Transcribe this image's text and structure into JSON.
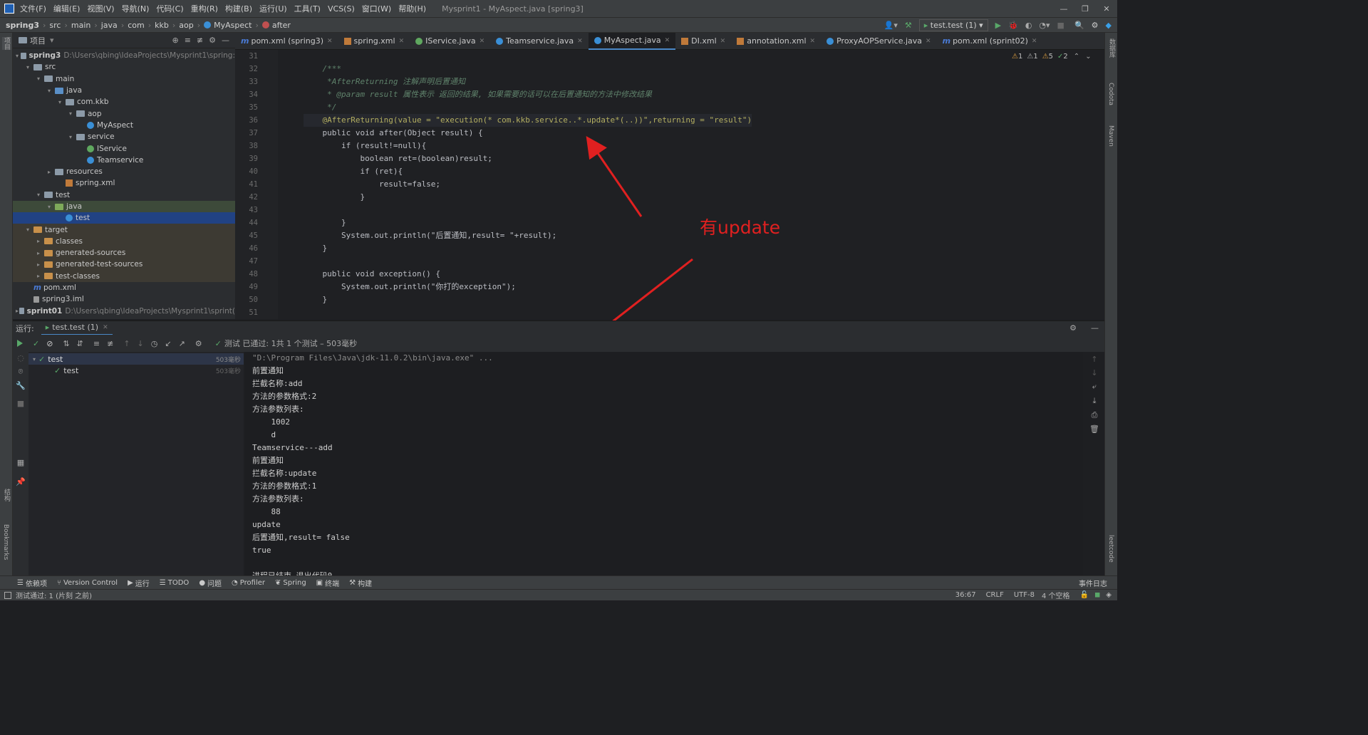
{
  "window": {
    "title": "Mysprint1 - MyAspect.java [spring3]",
    "menus": [
      "文件(F)",
      "编辑(E)",
      "视图(V)",
      "导航(N)",
      "代码(C)",
      "重构(R)",
      "构建(B)",
      "运行(U)",
      "工具(T)",
      "VCS(S)",
      "窗口(W)",
      "帮助(H)"
    ]
  },
  "breadcrumb": [
    "spring3",
    "src",
    "main",
    "java",
    "com",
    "kkb",
    "aop",
    "MyAspect",
    "after"
  ],
  "run_config": "test.test (1)",
  "project": {
    "header": "项目",
    "tree": [
      {
        "label": "spring3",
        "extra": "D:\\Users\\qbing\\IdeaProjects\\Mysprint1\\spring:",
        "icon": "module",
        "level": 0
      },
      {
        "label": "src",
        "icon": "folder",
        "level": 1
      },
      {
        "label": "main",
        "icon": "folder",
        "level": 2
      },
      {
        "label": "java",
        "icon": "folder-blue",
        "level": 3
      },
      {
        "label": "com.kkb",
        "icon": "package",
        "level": 4
      },
      {
        "label": "aop",
        "icon": "package",
        "level": 5
      },
      {
        "label": "MyAspect",
        "icon": "class",
        "level": 6
      },
      {
        "label": "service",
        "icon": "package",
        "level": 5
      },
      {
        "label": "IService",
        "icon": "interface",
        "level": 6
      },
      {
        "label": "Teamservice",
        "icon": "class",
        "level": 6
      },
      {
        "label": "resources",
        "icon": "folder",
        "level": 3
      },
      {
        "label": "spring.xml",
        "icon": "xml",
        "level": 4
      },
      {
        "label": "test",
        "icon": "folder",
        "level": 2
      },
      {
        "label": "java",
        "icon": "folder-green",
        "level": 3
      },
      {
        "label": "test",
        "icon": "class",
        "level": 4
      },
      {
        "label": "target",
        "icon": "folder-orange",
        "level": 1
      },
      {
        "label": "classes",
        "icon": "folder-orange",
        "level": 2
      },
      {
        "label": "generated-sources",
        "icon": "folder-orange",
        "level": 2
      },
      {
        "label": "generated-test-sources",
        "icon": "folder-orange",
        "level": 2
      },
      {
        "label": "test-classes",
        "icon": "folder-orange",
        "level": 2
      },
      {
        "label": "pom.xml",
        "icon": "maven",
        "level": 1
      },
      {
        "label": "spring3.iml",
        "icon": "iml",
        "level": 1
      },
      {
        "label": "sprint01",
        "extra": "D:\\Users\\qbing\\IdeaProjects\\Mysprint1\\sprint(",
        "icon": "module",
        "level": 0
      }
    ]
  },
  "tabs": [
    {
      "label": "pom.xml (spring3)",
      "icon": "maven"
    },
    {
      "label": "spring.xml",
      "icon": "xml"
    },
    {
      "label": "IService.java",
      "icon": "interface"
    },
    {
      "label": "Teamservice.java",
      "icon": "class"
    },
    {
      "label": "MyAspect.java",
      "icon": "class",
      "active": true
    },
    {
      "label": "DI.xml",
      "icon": "xml"
    },
    {
      "label": "annotation.xml",
      "icon": "xml"
    },
    {
      "label": "ProxyAOPService.java",
      "icon": "class"
    },
    {
      "label": "pom.xml (sprint02)",
      "icon": "maven"
    }
  ],
  "inspections": {
    "w1": "1",
    "w2": "1",
    "w3": "5",
    "ok": "2"
  },
  "editor": {
    "line_numbers": [
      "31",
      "32",
      "33",
      "34",
      "35",
      "36",
      "37",
      "38",
      "39",
      "40",
      "41",
      "42",
      "43",
      "44",
      "45",
      "46",
      "47",
      "48",
      "49",
      "50",
      "51"
    ],
    "lines": [
      "",
      "    /***",
      "     *AfterReturning 注解声明后置通知",
      "     * @param result 属性表示 返回的结果, 如果需要的话可以在后置通知的方法中修改结果",
      "     */",
      "    @AfterReturning(value = \"execution(* com.kkb.service..*.update*(..))\",returning = \"result\")",
      "    public void after(Object result) {",
      "        if (result!=null){",
      "            boolean ret=(boolean)result;",
      "            if (ret){",
      "                result=false;",
      "            }",
      "",
      "        }",
      "        System.out.println(\"后置通知,result= \"+result);",
      "    }",
      "",
      "    public void exception() {",
      "        System.out.println(\"你打的exception\");",
      "    }",
      ""
    ]
  },
  "annotation": {
    "text": "有update",
    "color": "#e02020"
  },
  "run": {
    "label": "运行:",
    "tab": "test.test (1)",
    "status": "测试 已通过: 1共 1 个测试 – 503毫秒",
    "tree": [
      {
        "label": "test",
        "time": "503毫秒"
      },
      {
        "label": "test",
        "time": "503毫秒"
      }
    ],
    "console": [
      "\"D:\\Program Files\\Java\\jdk-11.0.2\\bin\\java.exe\" ...",
      "前置通知",
      "拦截名称:add",
      "方法的参数格式:2",
      "方法参数列表:",
      "    1002",
      "    d",
      "Teamservice---add",
      "前置通知",
      "拦截名称:update",
      "方法的参数格式:1",
      "方法参数列表:",
      "    88",
      "update",
      "后置通知,result= false",
      "true",
      "",
      "进程已结束,退出代码0"
    ]
  },
  "toolwindows": [
    "依赖项",
    "Version Control",
    "运行",
    "TODO",
    "问题",
    "Profiler",
    "Spring",
    "终端",
    "构建"
  ],
  "event_log": "事件日志",
  "status": {
    "message": "测试通过: 1 (片刻 之前)",
    "position": "36:67",
    "line_sep": "CRLF",
    "encoding": "UTF-8",
    "indent": "4 个空格"
  },
  "side": {
    "left1": "项目",
    "left2": "结构",
    "left3": "Bookmarks",
    "right1": "数据库",
    "right2": "Codota",
    "right3": "Maven",
    "right4": "leetcode"
  },
  "colors": {
    "accent": "#4a88c7",
    "annotation": "#e02020",
    "pass": "#59a869"
  }
}
